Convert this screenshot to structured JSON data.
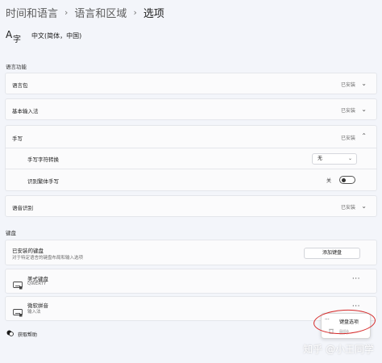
{
  "breadcrumb": {
    "item1": "时间和语言",
    "item2": "语言和区域",
    "current": "选项",
    "separator": "›"
  },
  "language": {
    "name": "中文(简体，中国)",
    "icon": "language-character-icon"
  },
  "language_features": {
    "section_label": "语言功能",
    "language_pack": {
      "label": "语言包",
      "status": "已安装"
    },
    "basic_input": {
      "label": "基本输入法",
      "status": "已安装"
    },
    "handwriting": {
      "label": "手写",
      "status": "已安装",
      "conversion_label": "手写字符转换",
      "conversion_value": "无",
      "recognize_label": "识别繁体手写",
      "recognize_state": "关"
    },
    "speech": {
      "label": "语音识别",
      "status": "已安装"
    }
  },
  "keyboard": {
    "section_label": "键盘",
    "installed_title": "已安装的键盘",
    "installed_subtitle": "对于特定语言的键盘布局和输入选项",
    "add_button": "添加键盘",
    "items": [
      {
        "name": "美式键盘",
        "detail": "QWERTY"
      },
      {
        "name": "微软拼音",
        "detail": "输入法"
      }
    ],
    "more_label": "···"
  },
  "context_menu": {
    "options": "键盘选项",
    "remove": "删除"
  },
  "help": "获取帮助",
  "watermark": "知乎 @小王同学",
  "colors": {
    "accent": "#005fb8",
    "annotation": "#d62a2a"
  }
}
